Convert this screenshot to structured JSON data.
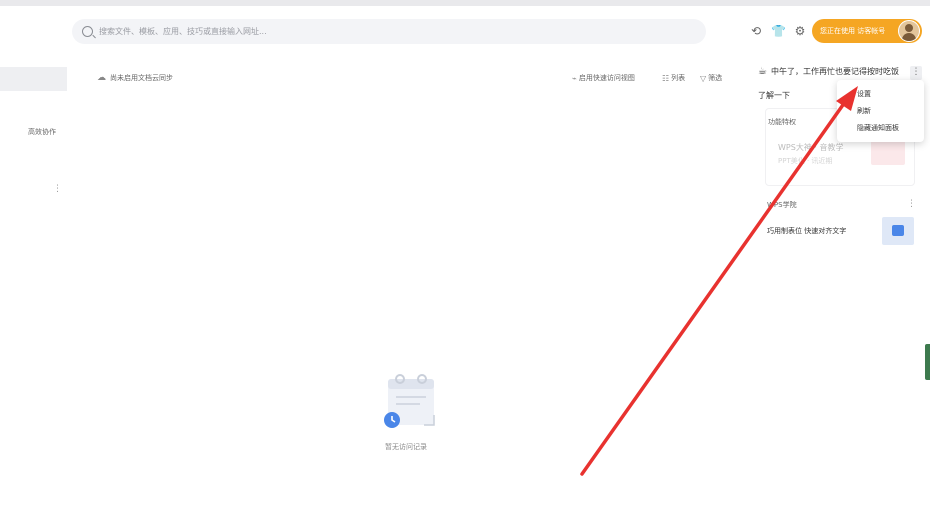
{
  "search": {
    "placeholder": "搜索文件、模板、应用、技巧或直接输入网址..."
  },
  "user": {
    "button_label": "您正在使用 访客帐号"
  },
  "sidebar": {
    "item_label": "高效协作"
  },
  "main": {
    "sync_text": "尚未启用文档云同步",
    "quick_view": "启用快速访问视图",
    "list_view": "列表",
    "filter": "筛选",
    "empty_text": "暂无访问记录"
  },
  "right_panel": {
    "greeting": "中午了，工作再忙也要记得按时吃饭",
    "learn_more": "了解一下",
    "feature_title": "功能特权",
    "feature_item": "WPS大神 · 音教学",
    "feature_sub": "PPT美化 · 讯近期",
    "college_title": "WPS学院",
    "college_item": "巧用制表位 快速对齐文字"
  },
  "context_menu": {
    "items": [
      "设置",
      "刷新",
      "隐藏通知面板"
    ]
  },
  "colors": {
    "accent": "#f5a623",
    "arrow": "#e8322f"
  }
}
